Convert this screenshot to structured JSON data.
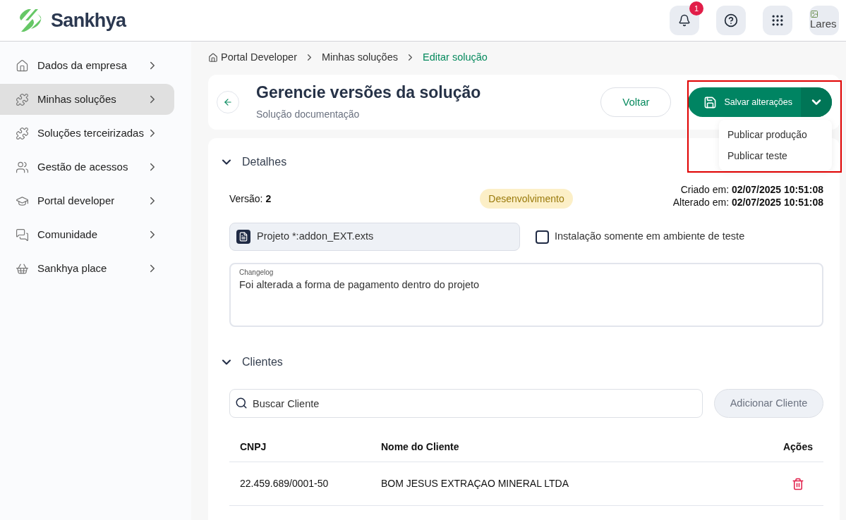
{
  "header": {
    "brand": "Sankhya",
    "notifications": {
      "count": "1"
    },
    "avatar": {
      "alt_text": "Lares"
    }
  },
  "sidebar": {
    "items": [
      {
        "label": "Dados da empresa",
        "selected": false
      },
      {
        "label": "Minhas soluções",
        "selected": true
      },
      {
        "label": "Soluções terceirizadas",
        "selected": false
      },
      {
        "label": "Gestão de acessos",
        "selected": false
      },
      {
        "label": "Portal developer",
        "selected": false
      },
      {
        "label": "Comunidade",
        "selected": false
      },
      {
        "label": "Sankhya place",
        "selected": false
      }
    ]
  },
  "breadcrumb": [
    {
      "label": "Portal Developer",
      "current": false
    },
    {
      "label": "Minhas soluções",
      "current": false
    },
    {
      "label": "Editar solução",
      "current": true
    }
  ],
  "page_header": {
    "title": "Gerencie versões da solução",
    "subtitle": "Solução documentação",
    "back_button": "Voltar",
    "save_button": "Salvar alterações",
    "menu_open": true,
    "menu_items": [
      "Publicar produção",
      "Publicar teste"
    ],
    "highlighted": true
  },
  "details": {
    "title": "Detalhes",
    "expanded": true,
    "version_label": "Versão:",
    "version": "2",
    "status": "Desenvolvimento",
    "created_label": "Criado em:",
    "created": "02/07/2025 10:51:08",
    "modified_label": "Alterado em:",
    "modified": "02/07/2025 10:51:08",
    "file": "Projeto *:addon_EXT.exts",
    "test_only": {
      "label": "Instalação somente em ambiente de teste",
      "checked": false
    },
    "changelog": {
      "label": "Changelog",
      "value": "Foi alterada a forma de pagamento dentro do projeto"
    }
  },
  "clients": {
    "title": "Clientes",
    "expanded": true,
    "search": {
      "placeholder": "Buscar Cliente"
    },
    "add_button": {
      "label": "Adicionar Cliente",
      "disabled": true
    },
    "table": {
      "columns": [
        "CNPJ",
        "Nome do Cliente",
        "Ações"
      ],
      "rows": [
        {
          "cnpj": "22.459.689/0001-50",
          "name": "BOM JESUS EXTRAÇAO MINERAL LTDA"
        }
      ]
    }
  }
}
